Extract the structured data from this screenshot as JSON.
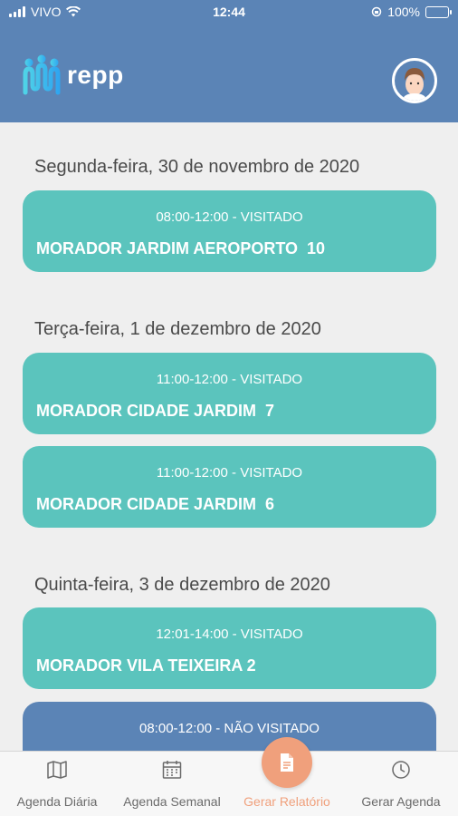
{
  "status_bar": {
    "carrier": "VIVO",
    "time": "12:44",
    "battery": "100%"
  },
  "header": {
    "logo_text": "repp",
    "logo_icon": "people-logo-icon",
    "profile_icon": "user-avatar-icon"
  },
  "agenda": {
    "day1": {
      "date": "Segunda-feira, 30 de novembro de 2020",
      "v1": {
        "status": "08:00-12:00 - VISITADO",
        "title": "MORADOR JARDIM AEROPORTO  10"
      }
    },
    "day2": {
      "date": "Terça-feira, 1 de dezembro de 2020",
      "v1": {
        "status": "11:00-12:00 - VISITADO",
        "title": "MORADOR CIDADE JARDIM  7"
      },
      "v2": {
        "status": "11:00-12:00 - VISITADO",
        "title": "MORADOR CIDADE JARDIM  6"
      }
    },
    "day3": {
      "date": "Quinta-feira, 3 de dezembro de 2020",
      "v1": {
        "status": "12:01-14:00 - VISITADO",
        "title": "MORADOR VILA TEIXEIRA 2"
      },
      "v2": {
        "status": "08:00-12:00 - NÃO VISITADO",
        "title": ""
      }
    }
  },
  "colors": {
    "primary": "#5b84b6",
    "visited": "#5bc4bd",
    "accent": "#f0a07c"
  },
  "nav": {
    "daily": {
      "label": "Agenda Diária",
      "icon": "map-icon"
    },
    "weekly": {
      "label": "Agenda Semanal",
      "icon": "calendar-icon"
    },
    "report": {
      "label": "Gerar Relatório",
      "icon": "document-icon"
    },
    "schedule": {
      "label": "Gerar Agenda",
      "icon": "clock-icon"
    }
  }
}
